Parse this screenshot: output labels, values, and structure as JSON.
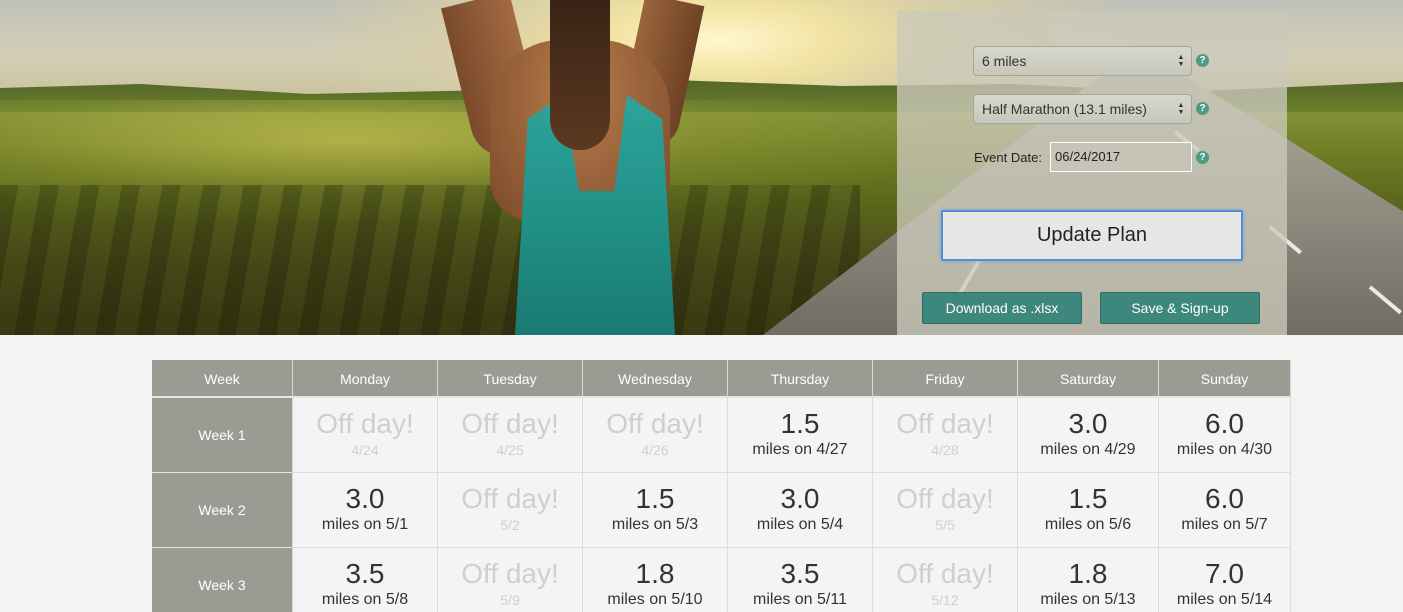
{
  "controls": {
    "distance_select": "6 miles",
    "event_select": "Half Marathon (13.1 miles)",
    "event_date_label": "Event Date:",
    "event_date_value": "06/24/2017",
    "help_glyph": "?",
    "update_button": "Update Plan",
    "download_button": "Download as .xlsx",
    "save_button": "Save & Sign-up"
  },
  "schedule": {
    "headers": [
      "Week",
      "Monday",
      "Tuesday",
      "Wednesday",
      "Thursday",
      "Friday",
      "Saturday",
      "Sunday"
    ],
    "weeks": [
      {
        "label": "Week 1",
        "days": [
          {
            "big": "Off day!",
            "sub": "4/24",
            "off": true
          },
          {
            "big": "Off day!",
            "sub": "4/25",
            "off": true
          },
          {
            "big": "Off day!",
            "sub": "4/26",
            "off": true
          },
          {
            "big": "1.5",
            "sub": "miles on 4/27",
            "off": false
          },
          {
            "big": "Off day!",
            "sub": "4/28",
            "off": true
          },
          {
            "big": "3.0",
            "sub": "miles on 4/29",
            "off": false
          },
          {
            "big": "6.0",
            "sub": "miles on 4/30",
            "off": false
          }
        ]
      },
      {
        "label": "Week 2",
        "days": [
          {
            "big": "3.0",
            "sub": "miles on 5/1",
            "off": false
          },
          {
            "big": "Off day!",
            "sub": "5/2",
            "off": true
          },
          {
            "big": "1.5",
            "sub": "miles on 5/3",
            "off": false
          },
          {
            "big": "3.0",
            "sub": "miles on 5/4",
            "off": false
          },
          {
            "big": "Off day!",
            "sub": "5/5",
            "off": true
          },
          {
            "big": "1.5",
            "sub": "miles on 5/6",
            "off": false
          },
          {
            "big": "6.0",
            "sub": "miles on 5/7",
            "off": false
          }
        ]
      },
      {
        "label": "Week 3",
        "days": [
          {
            "big": "3.5",
            "sub": "miles on 5/8",
            "off": false
          },
          {
            "big": "Off day!",
            "sub": "5/9",
            "off": true
          },
          {
            "big": "1.8",
            "sub": "miles on 5/10",
            "off": false
          },
          {
            "big": "3.5",
            "sub": "miles on 5/11",
            "off": false
          },
          {
            "big": "Off day!",
            "sub": "5/12",
            "off": true
          },
          {
            "big": "1.8",
            "sub": "miles on 5/13",
            "off": false
          },
          {
            "big": "7.0",
            "sub": "miles on 5/14",
            "off": false
          }
        ]
      }
    ]
  },
  "colors": {
    "accent_teal": "#3e877c",
    "header_gray": "#9a9c93",
    "help_icon": "#4f9a86",
    "focus_blue": "#4f8fe0"
  }
}
